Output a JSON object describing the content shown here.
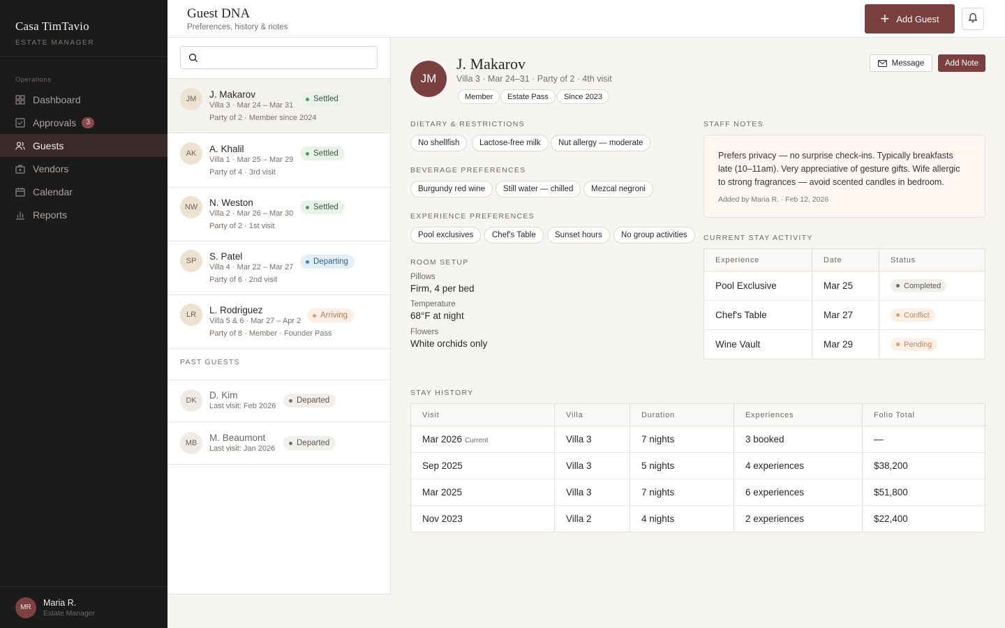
{
  "sidebar": {
    "brand": "Casa TimTavio",
    "brand_sub": "ESTATE MANAGER",
    "section": "Operations",
    "items": [
      {
        "label": "Dashboard",
        "icon": "grid-icon"
      },
      {
        "label": "Approvals",
        "icon": "check-square-icon",
        "badge": "3"
      },
      {
        "label": "Guests",
        "icon": "users-icon",
        "active": true
      },
      {
        "label": "Vendors",
        "icon": "briefcase-icon"
      },
      {
        "label": "Calendar",
        "icon": "calendar-icon"
      },
      {
        "label": "Reports",
        "icon": "bar-chart-icon"
      }
    ],
    "user": {
      "initials": "MR",
      "name": "Maria R.",
      "role": "Estate Manager"
    }
  },
  "header": {
    "title": "Guest DNA",
    "subtitle": "Preferences, history & notes",
    "add_guest": "Add Guest"
  },
  "guest_list": {
    "search_placeholder": "",
    "current": [
      {
        "initials": "JM",
        "name": "J. Makarov",
        "line1": "Villa 3 · Mar 24 – Mar 31",
        "line2": "Party of 2 · Member since 2024",
        "status": "Settled"
      },
      {
        "initials": "AK",
        "name": "A. Khalil",
        "line1": "Villa 1 · Mar 25 – Mar 29",
        "line2": "Party of 4 · 3rd visit",
        "status": "Settled"
      },
      {
        "initials": "NW",
        "name": "N. Weston",
        "line1": "Villa 2 · Mar 26 – Mar 30",
        "line2": "Party of 2 · 1st visit",
        "status": "Settled"
      },
      {
        "initials": "SP",
        "name": "S. Patel",
        "line1": "Villa 4 · Mar 22 – Mar 27",
        "line2": "Party of 6 · 2nd visit",
        "status": "Departing"
      },
      {
        "initials": "LR",
        "name": "L. Rodriguez",
        "line1": "Villa 5 & 6 · Mar 27 – Apr 2",
        "line2": "Party of 8 · Member · Founder Pass",
        "status": "Arriving"
      }
    ],
    "past_label": "PAST GUESTS",
    "past": [
      {
        "initials": "DK",
        "name": "D. Kim",
        "line1": "Last visit: Feb 2026",
        "status": "Departed"
      },
      {
        "initials": "MB",
        "name": "M. Beaumont",
        "line1": "Last visit: Jan 2026",
        "status": "Departed"
      }
    ]
  },
  "detail": {
    "initials": "JM",
    "name": "J. Makarov",
    "meta": "Villa 3 · Mar 24–31 · Party of 2 · 4th visit",
    "tags": [
      "Member",
      "Estate Pass",
      "Since 2023"
    ],
    "message_btn": "Message",
    "add_note_btn": "Add Note",
    "dietary_label": "DIETARY & RESTRICTIONS",
    "dietary": [
      "No shellfish",
      "Lactose-free milk",
      "Nut allergy — moderate"
    ],
    "beverage_label": "BEVERAGE PREFERENCES",
    "beverage": [
      "Burgundy red wine",
      "Still water — chilled",
      "Mezcal negroni"
    ],
    "experience_label": "EXPERIENCE PREFERENCES",
    "experience": [
      "Pool exclusives",
      "Chef's Table",
      "Sunset hours",
      "No group activities"
    ],
    "room_label": "ROOM SETUP",
    "room": [
      {
        "k": "Pillows",
        "v": "Firm, 4 per bed"
      },
      {
        "k": "Temperature",
        "v": "68°F at night"
      },
      {
        "k": "Flowers",
        "v": "White orchids only"
      }
    ],
    "notes_label": "STAFF NOTES",
    "notes_text": "Prefers privacy — no surprise check-ins. Typically breakfasts late (10–11am). Very appreciative of gesture gifts. Wife allergic to strong fragrances — avoid scented candles in bedroom.",
    "notes_by": "Added by Maria R. · Feb 12, 2026",
    "activity_label": "CURRENT STAY ACTIVITY",
    "activity_headers": [
      "Experience",
      "Date",
      "Status"
    ],
    "activity_rows": [
      {
        "experience": "Pool Exclusive",
        "date": "Mar 25",
        "status": "Completed"
      },
      {
        "experience": "Chef's Table",
        "date": "Mar 27",
        "status": "Conflict"
      },
      {
        "experience": "Wine Vault",
        "date": "Mar 29",
        "status": "Pending"
      }
    ],
    "history_label": "STAY HISTORY",
    "history_headers": [
      "Visit",
      "Villa",
      "Duration",
      "Experiences",
      "Folio Total"
    ],
    "history_rows": [
      {
        "visit": "Mar 2026",
        "current": "Current",
        "villa": "Villa 3",
        "duration": "7 nights",
        "experiences": "3 booked",
        "total": "—"
      },
      {
        "visit": "Sep 2025",
        "villa": "Villa 3",
        "duration": "5 nights",
        "experiences": "4 experiences",
        "total": "$38,200"
      },
      {
        "visit": "Mar 2025",
        "villa": "Villa 3",
        "duration": "7 nights",
        "experiences": "6 experiences",
        "total": "$51,800"
      },
      {
        "visit": "Nov 2023",
        "villa": "Villa 2",
        "duration": "4 nights",
        "experiences": "2 experiences",
        "total": "$22,400"
      }
    ]
  },
  "colors": {
    "accent": "#7a3f3f",
    "sidebar_bg": "#1c1b1b",
    "settled": "#4d9b57",
    "departing": "#2f7fcf",
    "arriving": "#e49a5d"
  }
}
